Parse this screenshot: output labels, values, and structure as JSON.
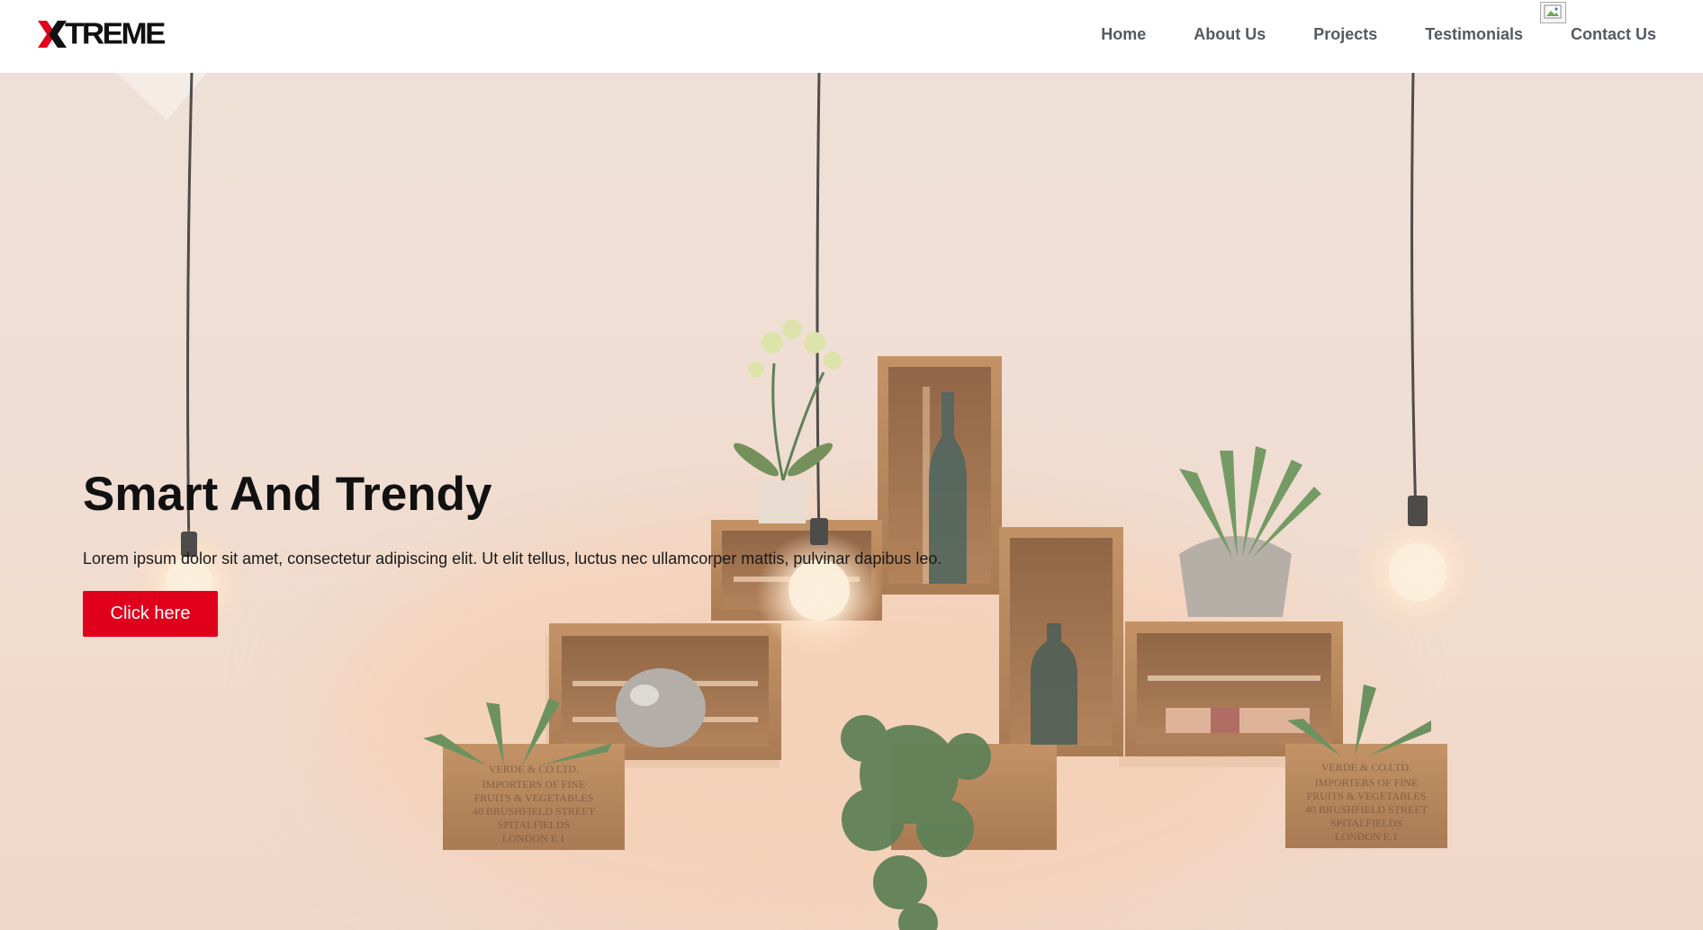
{
  "brand": {
    "name": "TREME",
    "mark": "X",
    "accent_color": "#e0001b"
  },
  "nav": {
    "items": [
      {
        "label": "Home"
      },
      {
        "label": "About Us"
      },
      {
        "label": "Projects"
      },
      {
        "label": "Testimonials"
      },
      {
        "label": "Contact Us"
      }
    ]
  },
  "hero": {
    "title": "Smart And Trendy",
    "text": "Lorem ipsum dolor sit amet, consectetur adipiscing elit. Ut elit tellus, luctus nec ullamcorper mattis, pulvinar dapibus leo.",
    "button_label": "Click here"
  }
}
